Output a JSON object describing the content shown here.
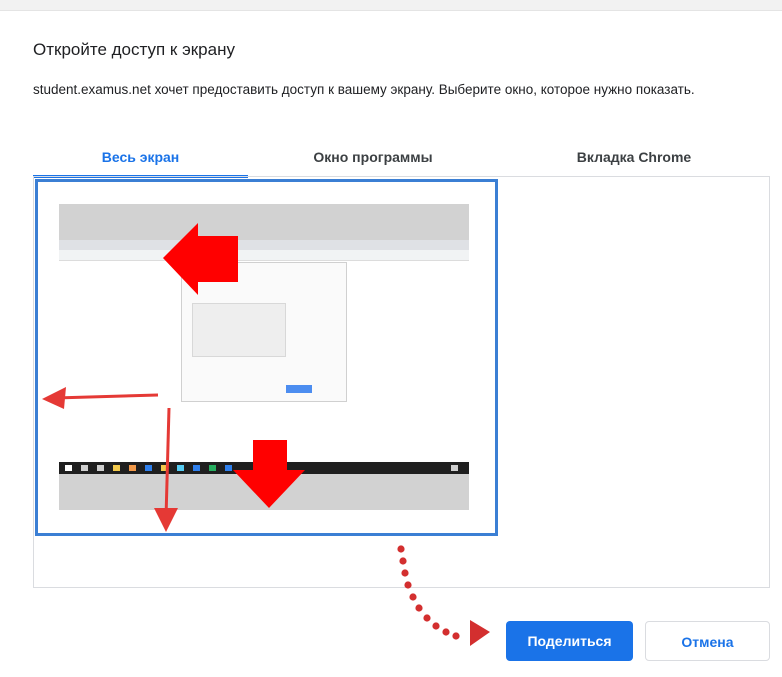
{
  "dialog": {
    "title": "Откройте доступ к экрану",
    "description": "student.examus.net хочет предоставить доступ к вашему экрану. Выберите окно, которое нужно показать."
  },
  "tabs": [
    {
      "label": "Весь экран",
      "active": true
    },
    {
      "label": "Окно программы",
      "active": false
    },
    {
      "label": "Вкладка Chrome",
      "active": false
    }
  ],
  "buttons": {
    "share_label": "Поделиться",
    "cancel_label": "Отмена"
  },
  "colors": {
    "accent": "#1a73e8",
    "selection_border": "#3b7fd4",
    "annotation_red": "#e53935"
  }
}
